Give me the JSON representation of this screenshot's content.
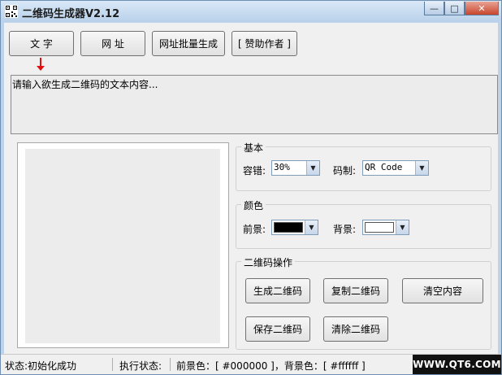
{
  "window": {
    "title": "二维码生成器V2.12",
    "minimize_glyph": "—",
    "maximize_glyph": "□",
    "close_glyph": "✕"
  },
  "toolbar": {
    "text_label": "文  字",
    "url_label": "网  址",
    "batch_url_label": "网址批量生成",
    "donate_label": "[ 赞助作者 ]"
  },
  "input": {
    "placeholder": "请输入欲生成二维码的文本内容..."
  },
  "basic": {
    "group_label": "基本",
    "error_correction_label": "容错:",
    "error_correction_value": "30%",
    "code_type_label": "码制:",
    "code_type_value": "QR Code"
  },
  "colors": {
    "group_label": "颜色",
    "foreground_label": "前景:",
    "foreground_value": "#000000",
    "background_label": "背景:",
    "background_value": "#ffffff"
  },
  "operations": {
    "group_label": "二维码操作",
    "generate_label": "生成二维码",
    "copy_label": "复制二维码",
    "clear_content_label": "清空内容",
    "save_label": "保存二维码",
    "remove_label": "清除二维码"
  },
  "status": {
    "state_text": "状态:初始化成功",
    "exec_text": "执行状态:",
    "color_text": "前景色：[ #000000 ]，背景色：[ #ffffff ]"
  },
  "watermark": {
    "text": "WWW.QT6.COM"
  },
  "icons": [
    "qr-app-icon",
    "chevron-down-icon",
    "red-arrow-icon"
  ]
}
